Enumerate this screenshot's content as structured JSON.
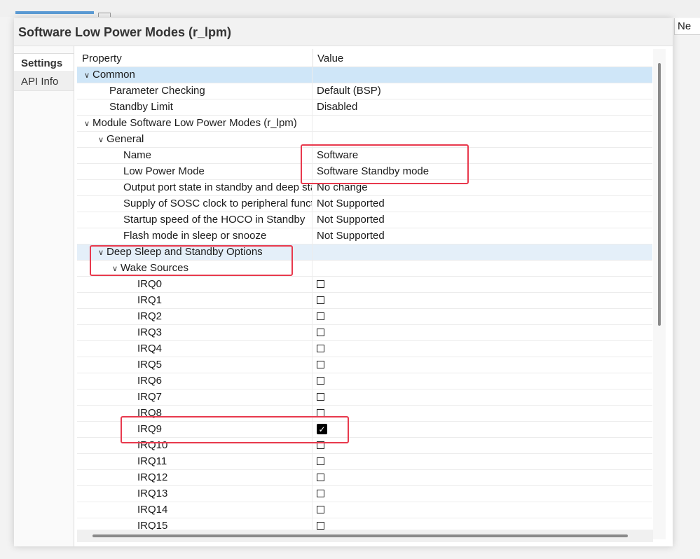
{
  "background": {
    "side_label": "Ne"
  },
  "dialog": {
    "title": "Software Low Power Modes (r_lpm)",
    "tabs": [
      "Settings",
      "API Info"
    ],
    "columns": {
      "property": "Property",
      "value": "Value"
    },
    "rows": [
      {
        "indent": 0,
        "chev": true,
        "label": "Common",
        "value": "",
        "style": "sel"
      },
      {
        "indent": 2,
        "chev": false,
        "label": "Parameter Checking",
        "value": "Default (BSP)"
      },
      {
        "indent": 2,
        "chev": false,
        "label": "Standby Limit",
        "value": "Disabled"
      },
      {
        "indent": 0,
        "chev": true,
        "label": "Module Software Low Power Modes (r_lpm)",
        "value": ""
      },
      {
        "indent": 1,
        "chev": true,
        "label": "General",
        "value": ""
      },
      {
        "indent": 3,
        "chev": false,
        "label": "Name",
        "value": "Software"
      },
      {
        "indent": 3,
        "chev": false,
        "label": "Low Power Mode",
        "value": "Software Standby mode"
      },
      {
        "indent": 3,
        "chev": false,
        "label": "Output port state in standby and deep standby",
        "value": "No change"
      },
      {
        "indent": 3,
        "chev": false,
        "label": "Supply of SOSC clock to peripheral functions",
        "value": "Not Supported"
      },
      {
        "indent": 3,
        "chev": false,
        "label": "Startup speed of the HOCO in Standby",
        "value": "Not Supported"
      },
      {
        "indent": 3,
        "chev": false,
        "label": "Flash mode in sleep or snooze",
        "value": "Not Supported"
      },
      {
        "indent": 1,
        "chev": true,
        "label": "Deep Sleep and Standby Options",
        "value": "",
        "style": "sec2"
      },
      {
        "indent": 2,
        "chev": true,
        "label": "Wake Sources",
        "value": ""
      },
      {
        "indent": 4,
        "label": "IRQ0",
        "checkbox": true,
        "checked": false
      },
      {
        "indent": 4,
        "label": "IRQ1",
        "checkbox": true,
        "checked": false
      },
      {
        "indent": 4,
        "label": "IRQ2",
        "checkbox": true,
        "checked": false
      },
      {
        "indent": 4,
        "label": "IRQ3",
        "checkbox": true,
        "checked": false
      },
      {
        "indent": 4,
        "label": "IRQ4",
        "checkbox": true,
        "checked": false
      },
      {
        "indent": 4,
        "label": "IRQ5",
        "checkbox": true,
        "checked": false
      },
      {
        "indent": 4,
        "label": "IRQ6",
        "checkbox": true,
        "checked": false
      },
      {
        "indent": 4,
        "label": "IRQ7",
        "checkbox": true,
        "checked": false
      },
      {
        "indent": 4,
        "label": "IRQ8",
        "checkbox": true,
        "checked": false
      },
      {
        "indent": 4,
        "label": "IRQ9",
        "checkbox": true,
        "checked": true
      },
      {
        "indent": 4,
        "label": "IRQ10",
        "checkbox": true,
        "checked": false
      },
      {
        "indent": 4,
        "label": "IRQ11",
        "checkbox": true,
        "checked": false
      },
      {
        "indent": 4,
        "label": "IRQ12",
        "checkbox": true,
        "checked": false
      },
      {
        "indent": 4,
        "label": "IRQ13",
        "checkbox": true,
        "checked": false
      },
      {
        "indent": 4,
        "label": "IRQ14",
        "checkbox": true,
        "checked": false
      },
      {
        "indent": 4,
        "label": "IRQ15",
        "checkbox": true,
        "checked": false
      }
    ]
  },
  "colors": {
    "highlight_box": "#e8394d",
    "selected_row": "#cfe6f8",
    "section_row": "#e4eff9"
  }
}
